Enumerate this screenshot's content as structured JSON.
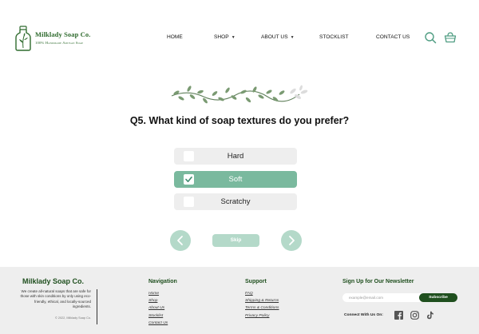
{
  "brand": {
    "name": "Milklady Soap Co.",
    "tagline": "100% Handmade Artisan Soap",
    "color": "#2f6b2e"
  },
  "nav": {
    "home": "HOME",
    "shop": "SHOP",
    "about": "ABOUT US",
    "stocklist": "STOCKLIST",
    "contact": "CONTACT US"
  },
  "header_icons": [
    "search-icon",
    "basket-icon"
  ],
  "quiz": {
    "question": "Q5. What kind of soap textures do you prefer?",
    "options": [
      {
        "label": "Hard",
        "checked": false
      },
      {
        "label": "Soft",
        "checked": true
      },
      {
        "label": "Scratchy",
        "checked": false
      }
    ],
    "skip_label": "Skip",
    "accent_color": "#7ab99e",
    "light_accent_color": "#b4d9c9"
  },
  "footer": {
    "brand": "Milklady Soap Co.",
    "description": "We create all-natural soaps that are safe for those with skin conditions by only using eco-friendly, ethical, and locally-sourced ingredients.",
    "copyright": "© 2022, Milklady Soap Co.",
    "navigation": {
      "heading": "Navigation",
      "links": [
        "Home",
        "Shop",
        "About Us",
        "Stocklist",
        "Contact Us"
      ]
    },
    "support": {
      "heading": "Support",
      "links": [
        "FAQ",
        "Shipping & Returns",
        "Terms & Conditions",
        "Privacy Policy"
      ]
    },
    "newsletter": {
      "heading": "Sign Up for Our Newsletter",
      "placeholder": "example@email.com",
      "button": "Subscribe",
      "connect": "Connect With Us On:",
      "socials": [
        "facebook-icon",
        "instagram-icon",
        "tiktok-icon"
      ]
    },
    "dark_color": "#1f4f1e"
  }
}
